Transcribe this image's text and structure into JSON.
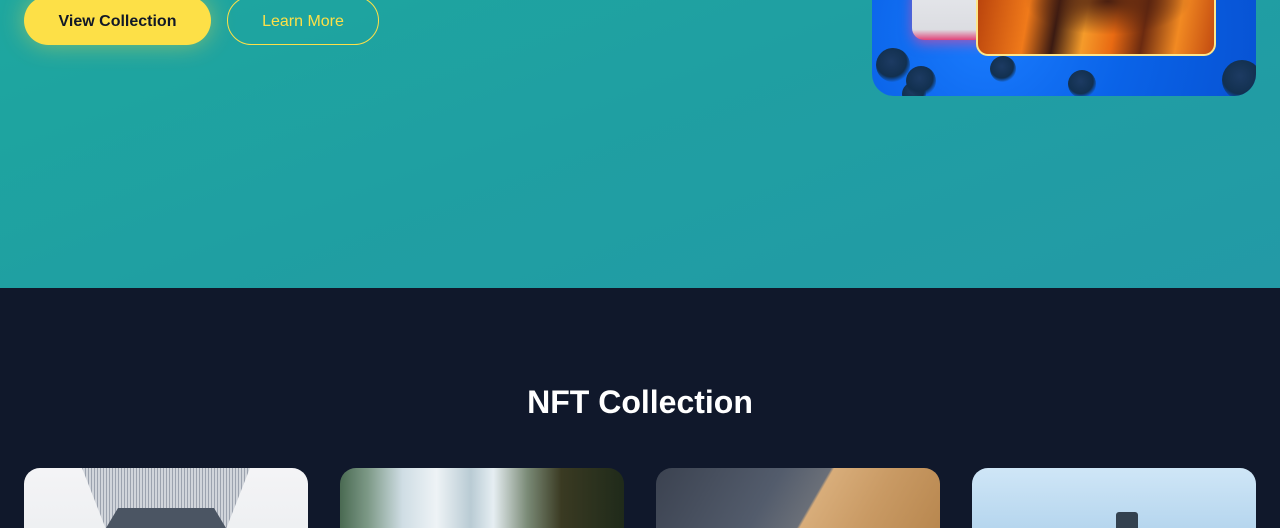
{
  "hero": {
    "primary_button_label": "View Collection",
    "secondary_button_label": "Learn More",
    "accent_color": "#fde047"
  },
  "collection": {
    "title": "NFT Collection",
    "cards": [
      {
        "image": "architecture-grid-thumbnail"
      },
      {
        "image": "waterfall-thumbnail"
      },
      {
        "image": "desert-dune-thumbnail"
      },
      {
        "image": "sky-tower-thumbnail"
      }
    ]
  }
}
